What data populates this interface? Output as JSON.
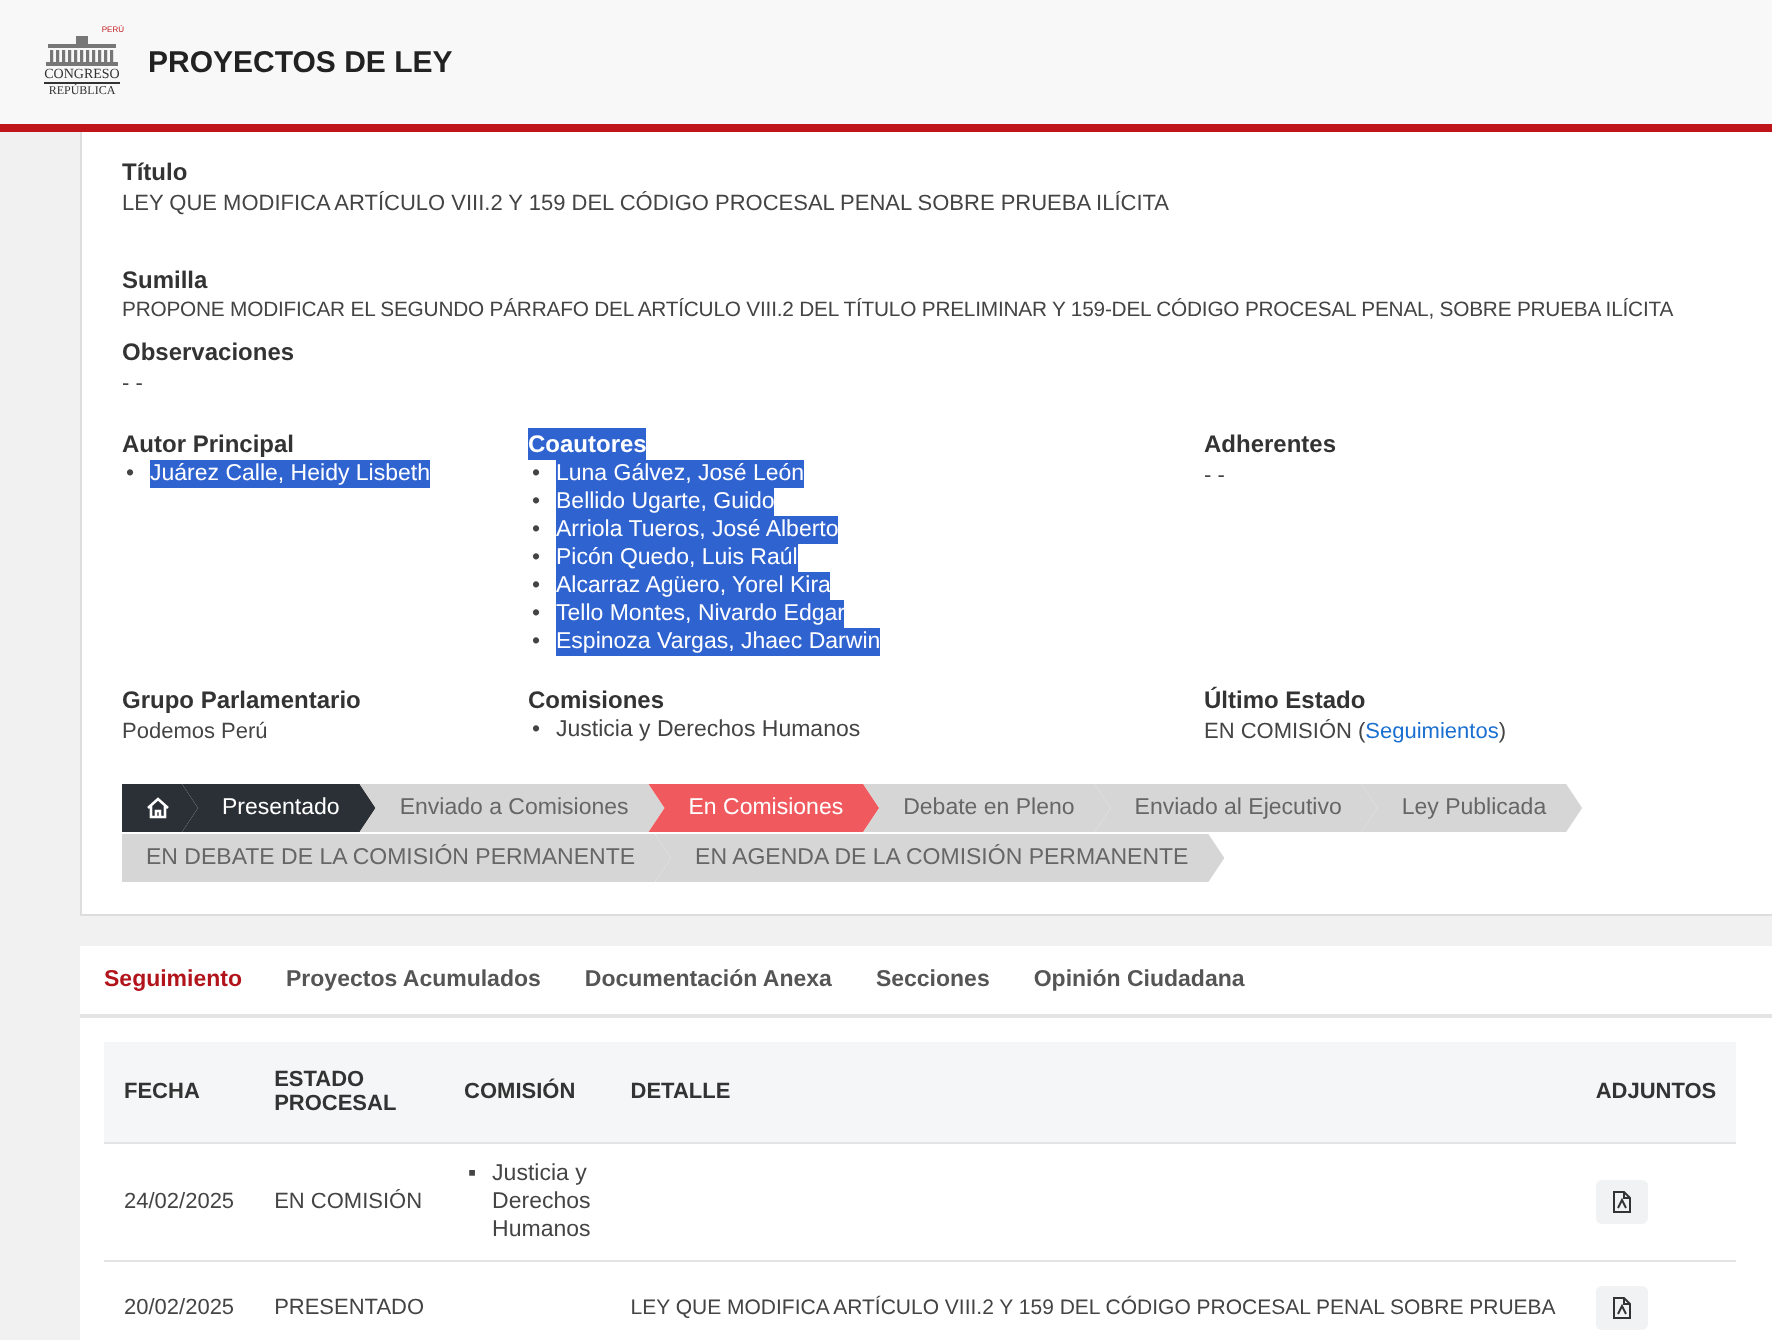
{
  "header": {
    "logo": {
      "top": "PERÚ",
      "name": "CONGRESO",
      "sub": "REPÚBLICA"
    },
    "title": "PROYECTOS DE LEY"
  },
  "detail": {
    "titulo": {
      "label": "Título",
      "value": "LEY QUE MODIFICA ARTÍCULO VIII.2 Y 159 DEL CÓDIGO PROCESAL PENAL SOBRE PRUEBA ILÍCITA"
    },
    "sumilla": {
      "label": "Sumilla",
      "value": "PROPONE MODIFICAR EL SEGUNDO PÁRRAFO DEL ARTÍCULO VIII.2 DEL TÍTULO PRELIMINAR Y 159-DEL CÓDIGO PROCESAL PENAL, SOBRE PRUEBA ILÍCITA"
    },
    "observaciones": {
      "label": "Observaciones",
      "value": "- -"
    },
    "people": [
      {
        "label": "Autor Principal",
        "highlighted": false,
        "kind": "list",
        "marker": "•",
        "items": [
          {
            "text": "Juárez Calle, Heidy Lisbeth",
            "highlighted": true
          }
        ]
      },
      {
        "label": "Coautores",
        "highlighted": true,
        "kind": "list",
        "marker": "•",
        "items": [
          {
            "text": "Luna Gálvez, José León",
            "highlighted": true
          },
          {
            "text": "Bellido Ugarte, Guido",
            "highlighted": true
          },
          {
            "text": "Arriola Tueros, José Alberto",
            "highlighted": true
          },
          {
            "text": "Picón Quedo, Luis Raúl",
            "highlighted": true
          },
          {
            "text": "Alcarraz Agüero, Yorel Kira",
            "highlighted": true
          },
          {
            "text": "Tello Montes, Nivardo Edgar",
            "highlighted": true
          },
          {
            "text": "Espinoza Vargas, Jhaec Darwin",
            "highlighted": true
          }
        ]
      },
      {
        "label": "Adherentes",
        "highlighted": false,
        "kind": "text",
        "value": "- -"
      }
    ],
    "info": [
      {
        "label": "Grupo Parlamentario",
        "kind": "text",
        "value": "Podemos Perú"
      },
      {
        "label": "Comisiones",
        "kind": "list",
        "marker": "•",
        "items": [
          {
            "text": "Justicia y Derechos Humanos",
            "highlighted": false
          }
        ]
      },
      {
        "label": "Último Estado",
        "kind": "status",
        "value": "EN COMISIÓN (",
        "link": "Seguimientos",
        "after": ")"
      }
    ],
    "steps": [
      [
        {
          "kind": "home",
          "done": true,
          "current": false
        },
        {
          "kind": "step",
          "label": "Presentado",
          "done": true,
          "current": false
        },
        {
          "kind": "step",
          "label": "Enviado a Comisiones",
          "done": false,
          "current": false
        },
        {
          "kind": "step",
          "label": "En Comisiones",
          "done": false,
          "current": true
        },
        {
          "kind": "step",
          "label": "Debate en Pleno",
          "done": false,
          "current": false
        },
        {
          "kind": "step",
          "label": "Enviado al Ejecutivo",
          "done": false,
          "current": false
        },
        {
          "kind": "step",
          "label": "Ley Publicada",
          "done": false,
          "current": false
        }
      ],
      [
        {
          "kind": "step",
          "label": "EN DEBATE DE LA COMISIÓN PERMANENTE",
          "done": false,
          "current": false
        },
        {
          "kind": "step",
          "label": "EN AGENDA DE LA COMISIÓN PERMANENTE",
          "done": false,
          "current": false
        }
      ]
    ]
  },
  "tabs": [
    {
      "label": "Seguimiento",
      "selected": true
    },
    {
      "label": "Proyectos Acumulados",
      "selected": false
    },
    {
      "label": "Documentación Anexa",
      "selected": false
    },
    {
      "label": "Secciones",
      "selected": false
    },
    {
      "label": "Opinión Ciudadana",
      "selected": false
    }
  ],
  "table": {
    "columns": [
      "FECHA",
      "ESTADO PROCESAL",
      "COMISIÓN",
      "DETALLE",
      "ADJUNTOS"
    ],
    "rows": [
      {
        "fecha": "24/02/2025",
        "estado": "EN COMISIÓN",
        "marker": "▪",
        "comisiones": [
          "Justicia y Derechos Humanos"
        ],
        "attachment": true
      },
      {
        "fecha": "20/02/2025",
        "estado": "PRESENTADO",
        "comisiones": [],
        "detalle": "LEY QUE MODIFICA ARTÍCULO VIII.2 Y 159 DEL CÓDIGO PROCESAL PENAL SOBRE PRUEBA",
        "attachment": true
      }
    ]
  }
}
